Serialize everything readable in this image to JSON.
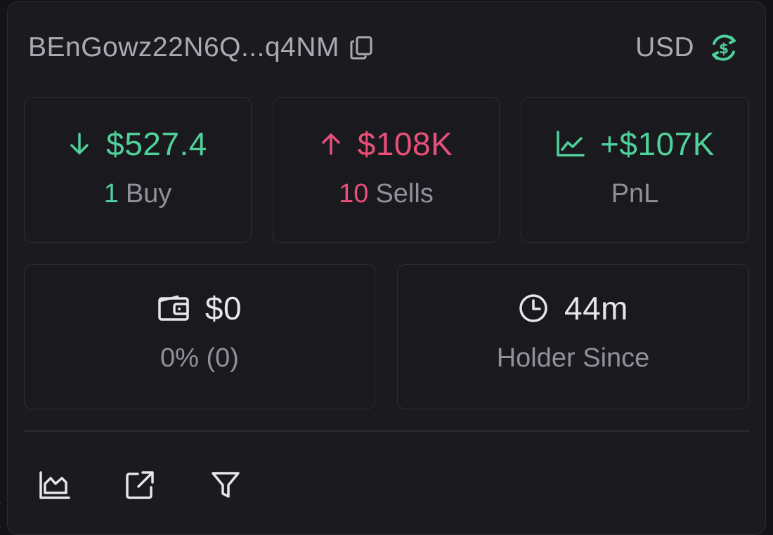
{
  "header": {
    "address": "BEnGowz22N6Q...q4NM",
    "currency": "USD"
  },
  "stats": {
    "buy": {
      "value": "$527.4",
      "count": "1",
      "label": "Buy"
    },
    "sell": {
      "value": "$108K",
      "count": "10",
      "label": "Sells"
    },
    "pnl": {
      "value": "+$107K",
      "label": "PnL"
    },
    "balance": {
      "value": "$0",
      "detail": "0% (0)"
    },
    "holder": {
      "value": "44m",
      "label": "Holder Since"
    }
  },
  "colors": {
    "positive": "#4fd19b",
    "negative": "#e8507a",
    "muted": "#8f909a"
  },
  "icons": {
    "copy": "copy-icon",
    "currency_toggle": "currency-swap-icon",
    "buy": "arrow-down-icon",
    "sell": "arrow-up-icon",
    "pnl": "line-chart-icon",
    "balance": "wallet-icon",
    "holder": "clock-icon",
    "tools": [
      "area-chart-icon",
      "external-link-icon",
      "filter-icon"
    ]
  }
}
